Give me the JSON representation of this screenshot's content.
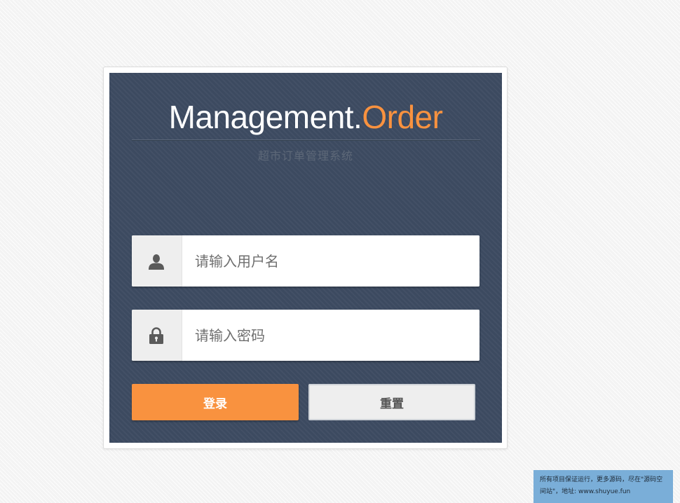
{
  "login": {
    "title_main": "Management.",
    "title_accent": "Order",
    "subtitle": "超市订单管理系统",
    "username": {
      "placeholder": "请输入用户名",
      "value": "",
      "icon": "user-icon"
    },
    "password": {
      "placeholder": "请输入密码",
      "value": "",
      "icon": "lock-icon"
    },
    "login_button": "登录",
    "reset_button": "重置"
  },
  "colors": {
    "panel_background": "#3c4a60",
    "accent": "#f9923f",
    "notice_background": "#7aaed8"
  },
  "notice": {
    "text": "所有项目保证运行，更多源码，尽在\"源码空间站\"，地址: www.shuyue.fun"
  }
}
